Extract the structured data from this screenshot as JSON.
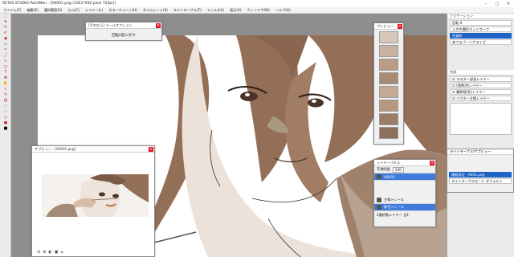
{
  "window": {
    "title": "RETAS STUDIO PaintMan - [A0001.png (1561*936 pixel 72dpi)]",
    "controls": [
      "–",
      "□",
      "✕"
    ]
  },
  "menu": [
    "ファイル(F)",
    "編集(E)",
    "選択範囲(S)",
    "セル(C)",
    "レイヤー(L)",
    "カラーチャート(H)",
    "タイムシート(S)",
    "ライトテーブル(T)",
    "フィルタ(I)",
    "表示(V)",
    "ウィンドウ(W)",
    "ヘルプ(H)"
  ],
  "tool_option": {
    "title": "[手のひら] ツールオプション",
    "body": "回転0度に戻す"
  },
  "preview": {
    "title": "プレビュー"
  },
  "subview": {
    "title": "サブビュー - [A0001.png]",
    "icons": [
      "⊖",
      "⊕",
      "◐",
      "▣",
      "⌂"
    ]
  },
  "layer_panel": {
    "title": "レイヤーパネル",
    "mode_label": "不透明度",
    "mode_value": "100",
    "layers": [
      {
        "name": "A0001",
        "selected": true
      },
      {
        "name": "主線トレース",
        "selected": false
      },
      {
        "name": "影色トレース",
        "selected": true
      }
    ],
    "footer": "2選択数レイヤー 全1"
  },
  "right_panel": {
    "nav_title": "ナビゲーション",
    "nav_label": "回転",
    "nav_value": "0",
    "items": [
      {
        "label": "入力中選択ネットワーク",
        "selected": false
      },
      {
        "label": "色選択",
        "selected": true
      },
      {
        "label": "あてなパーソナライズ",
        "selected": false
      }
    ],
    "layer_opts_title": "合成",
    "checks": [
      "ラスター部塗レイヤー",
      "(透明)色レイヤー",
      "輪郭線(色)レイヤー",
      "ベクター主線レイヤー"
    ]
  },
  "subtool": {
    "title": "ライトテーブル/サブビュー",
    "rows": [
      {
        "label": "撮影設定 - A001.png",
        "selected": true
      },
      {
        "label": "ライトテーブルモード デフォルト",
        "selected": false
      }
    ]
  }
}
